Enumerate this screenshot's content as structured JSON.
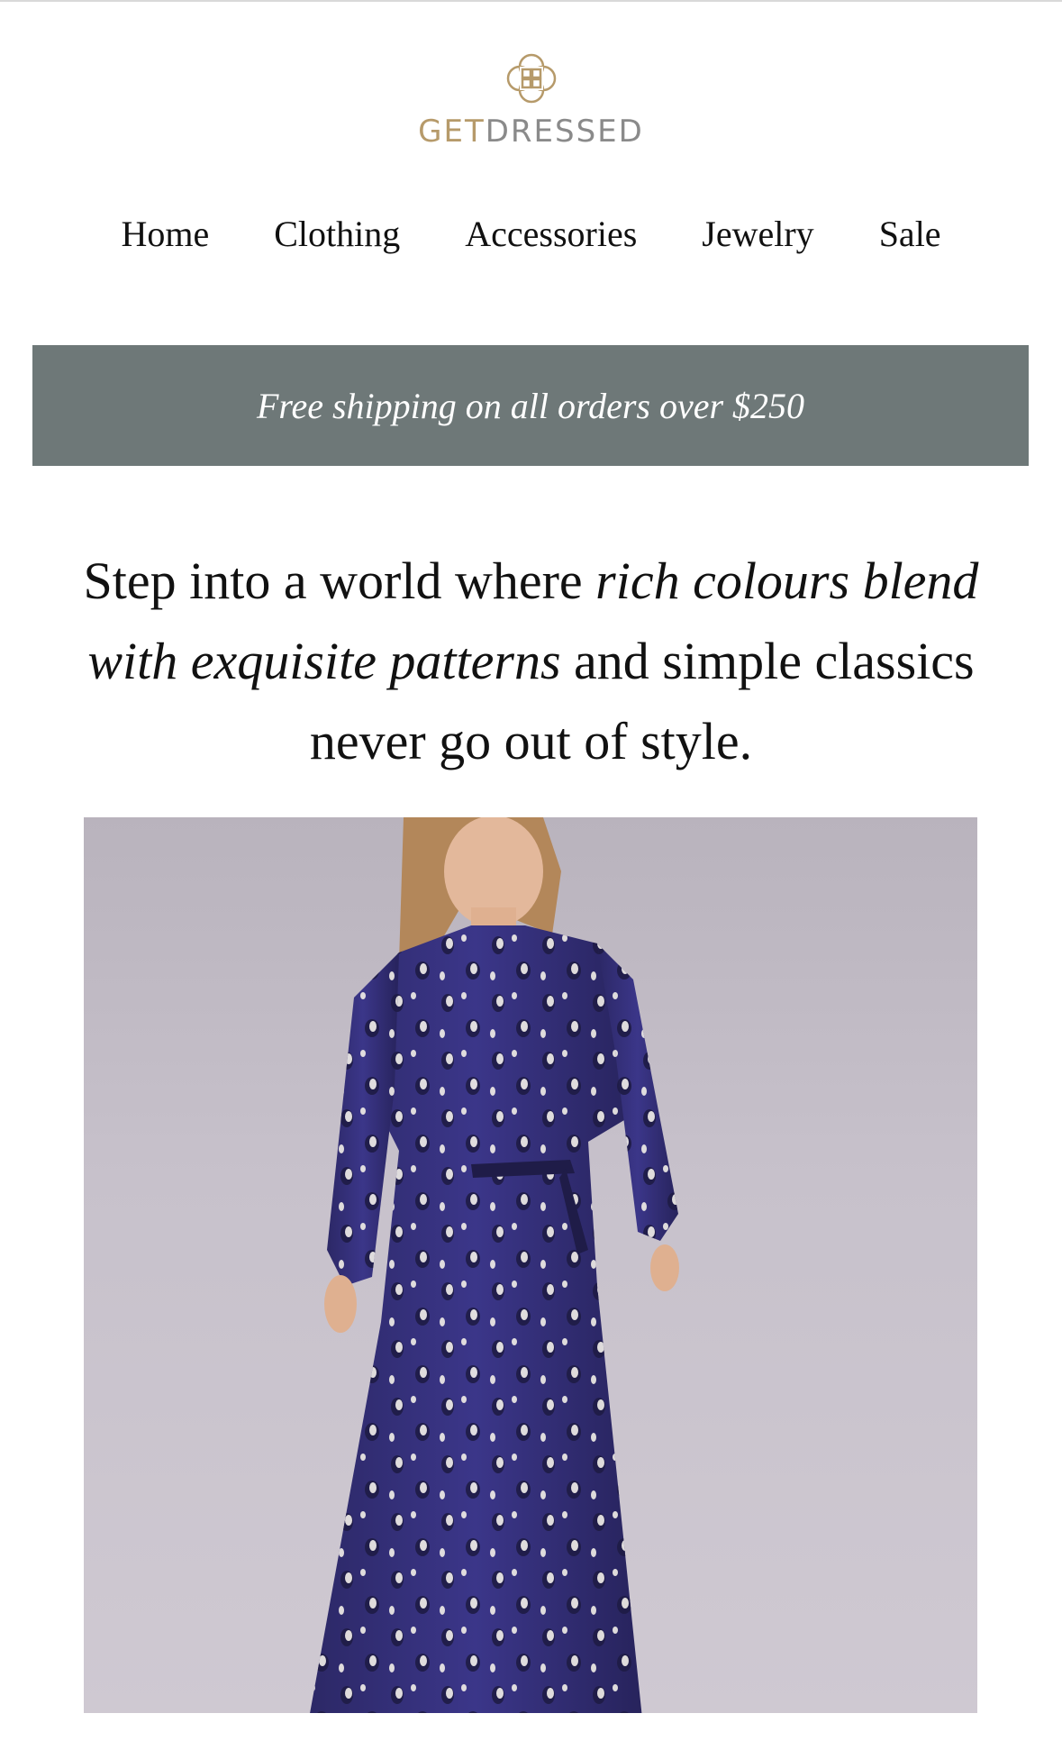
{
  "brand": {
    "name_part1": "GET",
    "name_part2": "DRESSED",
    "logo_icon": "quatrefoil-logo-icon",
    "colors": {
      "gold": "#b69a6a",
      "gray": "#8a8a8a"
    }
  },
  "nav": {
    "items": [
      {
        "label": "Home"
      },
      {
        "label": "Clothing"
      },
      {
        "label": "Accessories"
      },
      {
        "label": "Jewelry"
      },
      {
        "label": "Sale"
      }
    ]
  },
  "banner": {
    "text": "Free shipping on all orders over $250",
    "background": "#6e7878"
  },
  "headline": {
    "part1": "Step into a world where ",
    "part2_italic": "rich colours blend with exquisite patterns",
    "part3": " and simple classics never go out of style."
  },
  "hero": {
    "description_icon": "model-in-navy-leopard-print-dress-image"
  }
}
